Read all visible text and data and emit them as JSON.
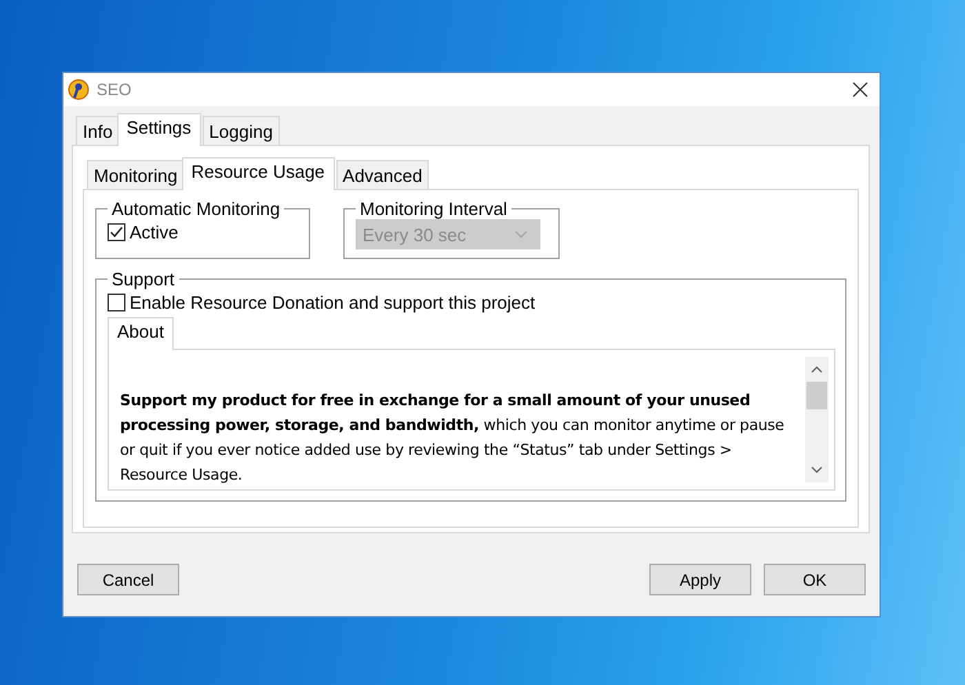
{
  "window": {
    "title": "SEO"
  },
  "tabs": [
    {
      "label": "Info",
      "selected": false
    },
    {
      "label": "Settings",
      "selected": true
    },
    {
      "label": "Logging",
      "selected": false
    }
  ],
  "subtabs": [
    {
      "label": "Monitoring",
      "selected": false
    },
    {
      "label": "Resource Usage",
      "selected": true
    },
    {
      "label": "Advanced",
      "selected": false
    }
  ],
  "automatic_monitoring": {
    "title": "Automatic Monitoring",
    "active": {
      "label": "Active",
      "checked": true
    }
  },
  "monitoring_interval": {
    "title": "Monitoring Interval",
    "value": "Every 30 sec",
    "disabled": true
  },
  "support": {
    "title": "Support",
    "donation": {
      "label": "Enable Resource Donation and support this project",
      "checked": false
    },
    "about_tabs": [
      {
        "label": "About",
        "selected": true
      }
    ],
    "about_text": "**Support my product for free in exchange for a small amount of your unused processing power, storage, and bandwidth,** which you can monitor anytime or pause or quit if you ever notice added use by reviewing the “Status” tab under Settings > Resource Usage."
  },
  "buttons": [
    {
      "label": "Cancel",
      "kind": "left"
    },
    {
      "label": "Apply",
      "kind": "right"
    },
    {
      "label": "OK",
      "kind": "right"
    }
  ]
}
